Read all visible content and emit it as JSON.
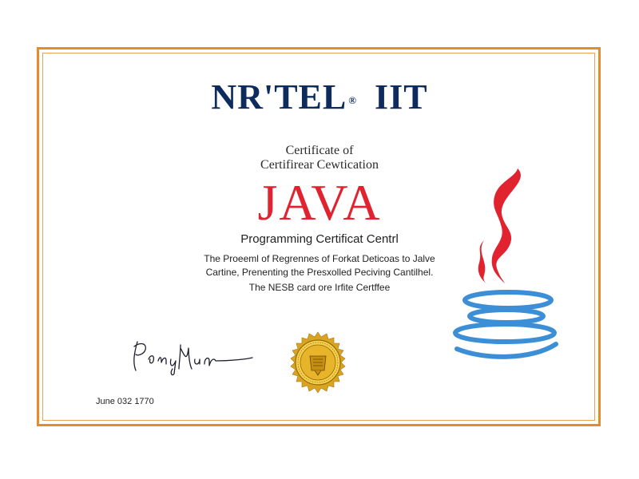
{
  "certificate": {
    "org_name": "NR'TEL",
    "org_reg_mark": "®",
    "org_suffix": "IIT",
    "subtitle_line1": "Certificate of",
    "subtitle_line2": "Certifirear Cewtication",
    "main_title": "JAVA",
    "program_title": "Programming Certificat Centrl",
    "description_line1": "The Proeeml of Regrennes of Forkat Deticoas to Jalve",
    "description_line2": "Cartine, Prenenting the Presxolled Peciving Cantilhel.",
    "description_line3": "The NESB card ore Irfite Certffee",
    "date": "June 032 1770"
  },
  "colors": {
    "border": "#e88a2c",
    "title_navy": "#0d2b5c",
    "java_red": "#e0232f",
    "java_blue": "#3c8fd6",
    "seal_gold": "#d9a520"
  },
  "icons": {
    "signature": "signature-icon",
    "seal": "gold-seal-icon",
    "logo": "java-coffee-cup-icon"
  }
}
